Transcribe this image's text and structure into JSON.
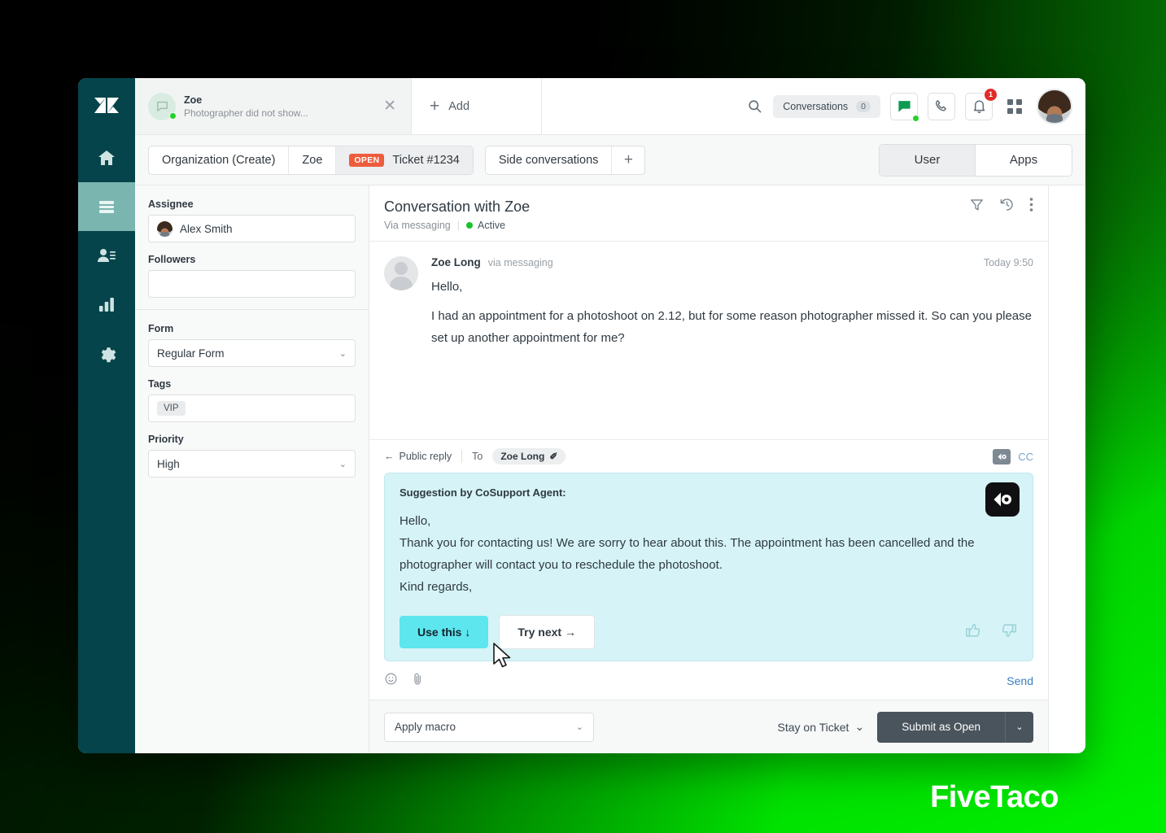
{
  "brand": "FiveTaco",
  "rail": {
    "items": [
      {
        "name": "zendesk-logo",
        "label": "Zendesk"
      },
      {
        "name": "home",
        "label": "Home"
      },
      {
        "name": "views",
        "label": "Views"
      },
      {
        "name": "customers",
        "label": "Customers"
      },
      {
        "name": "reporting",
        "label": "Reporting"
      },
      {
        "name": "admin",
        "label": "Admin"
      }
    ]
  },
  "topbar": {
    "conversation_tab": {
      "title": "Zoe",
      "subtitle": "Photographer did not show...",
      "close_label": "✕",
      "status": "online"
    },
    "add_label": "Add",
    "search_label": "Search",
    "conversations_label": "Conversations",
    "conversations_count": "0",
    "chat_label": "Chat",
    "talk_label": "Talk",
    "notifications_label": "Notifications",
    "notifications_count": "1",
    "products_label": "Products",
    "avatar_label": "Account"
  },
  "tabstrip": {
    "breadcrumb": [
      {
        "label": "Organization (Create)",
        "active": false
      },
      {
        "label": "Zoe",
        "active": false
      },
      {
        "label": "Ticket #1234",
        "badge": "OPEN",
        "active": true
      }
    ],
    "side_conversations_label": "Side conversations",
    "side_conversations_add": "+",
    "segments": [
      {
        "label": "User",
        "selected": true
      },
      {
        "label": "Apps",
        "selected": false
      }
    ]
  },
  "properties": {
    "assignee": {
      "label": "Assignee",
      "value": "Alex Smith"
    },
    "followers": {
      "label": "Followers",
      "value": ""
    },
    "form": {
      "label": "Form",
      "value": "Regular Form",
      "chevron": "⌄"
    },
    "tags": {
      "label": "Tags",
      "chips": [
        "VIP"
      ]
    },
    "priority": {
      "label": "Priority",
      "value": "High",
      "chevron": "⌄"
    }
  },
  "conversation": {
    "title": "Conversation with Zoe",
    "channel": "Via messaging",
    "status": "Active",
    "actions": [
      "filter-icon",
      "history-icon",
      "more-icon"
    ],
    "messages": [
      {
        "author": "Zoe Long",
        "via": "via messaging",
        "time": "Today 9:50",
        "lines": [
          "Hello,",
          "I had an appointment for a photoshoot on 2.12, but for some reason photographer missed it. So can you please set up another appointment for me?"
        ]
      }
    ]
  },
  "composer": {
    "reply_type": "Public reply",
    "reply_arrow": "←",
    "to_label": "To",
    "recipient": "Zoe Long",
    "recipient_edit": "✐",
    "cc_label": "CC",
    "suggestion": {
      "title": "Suggestion by CoSupport Agent:",
      "lines": [
        "Hello,",
        "Thank you for contacting us! We are sorry to hear about this. The appointment has been cancelled  and the photographer will contact you to reschedule the photoshoot.",
        "Kind regards,"
      ],
      "use_this_label": "Use this ↓",
      "try_next_label": "Try next →",
      "thumbs_up_label": "Helpful",
      "thumbs_down_label": "Not helpful"
    },
    "emoji_label": "Emoji",
    "attach_label": "Attach file",
    "send_label": "Send"
  },
  "actionbar": {
    "macro_placeholder": "Apply macro",
    "macro_chevron": "⌄",
    "stay_label": "Stay on Ticket",
    "stay_chevron": "⌄",
    "submit_label": "Submit as Open",
    "submit_caret": "⌄"
  },
  "colors": {
    "rail_bg": "#04444a",
    "rail_active": "#7ab5b0",
    "open_badge": "#ed5c3c",
    "suggestion_bg": "#d6f4f7",
    "use_this_bg": "#5ee6ee",
    "submit_bg": "#49545c",
    "accent_green": "#00e800",
    "notification_red": "#e02b27"
  }
}
